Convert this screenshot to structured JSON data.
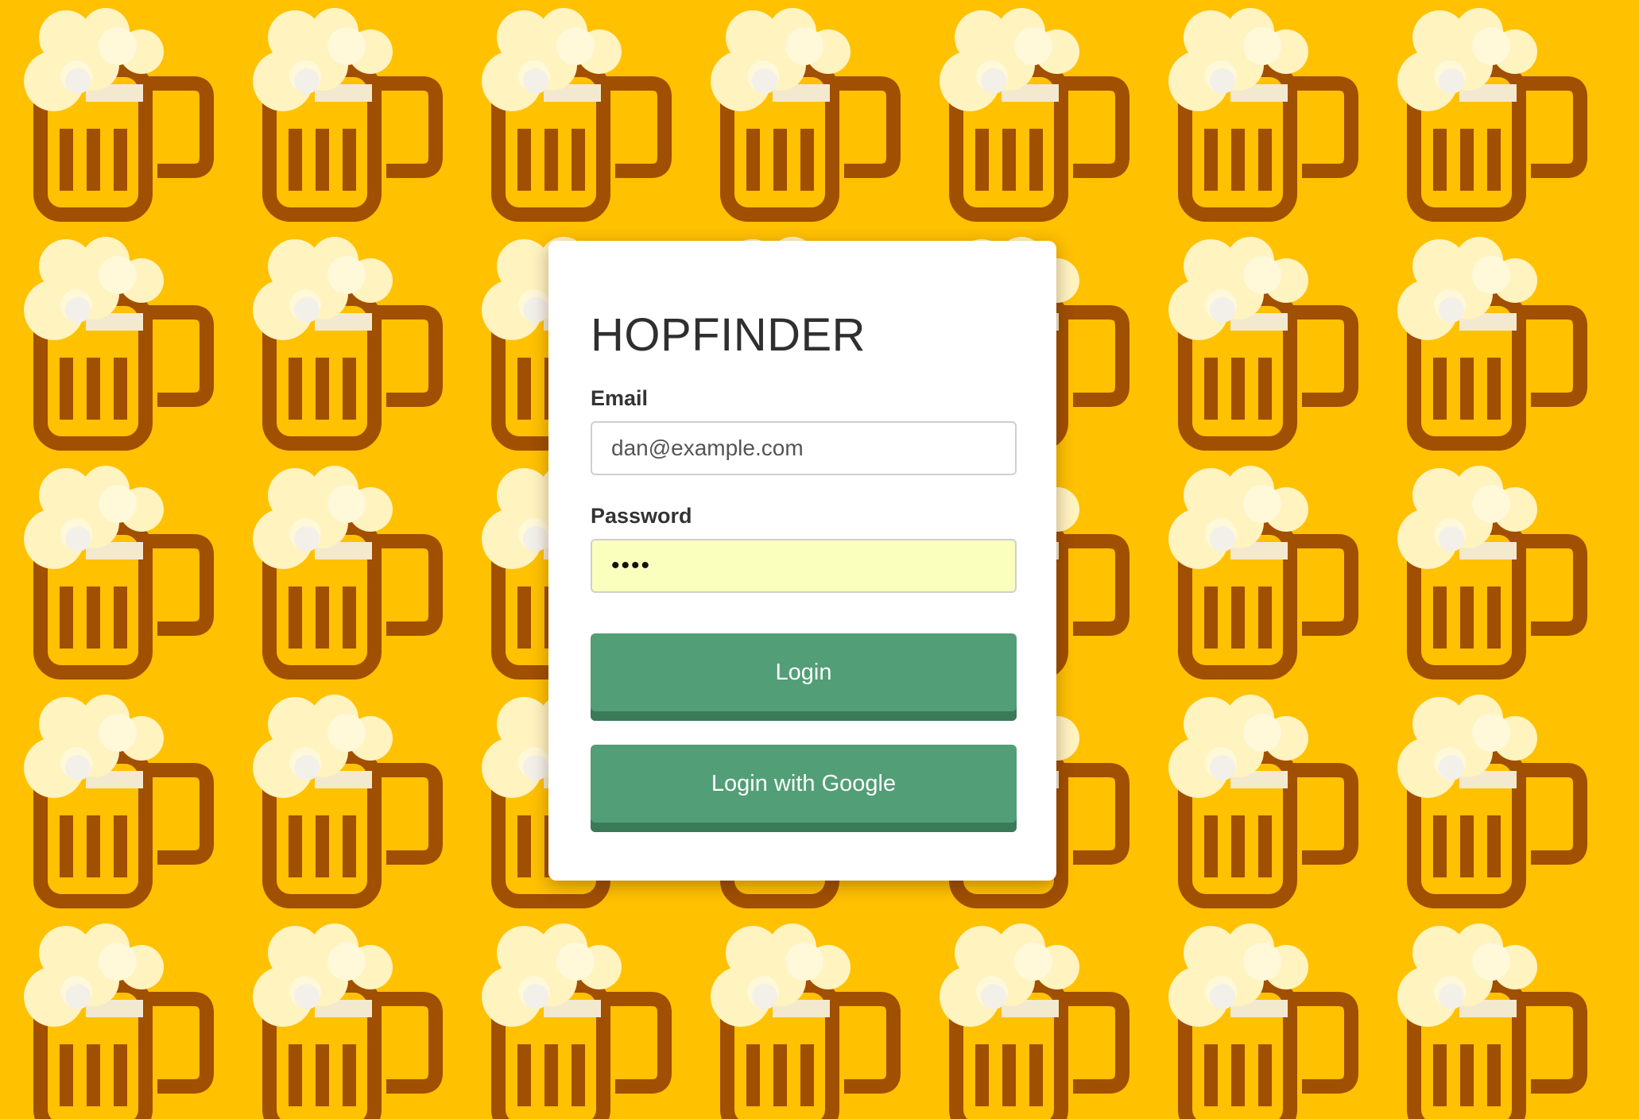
{
  "colors": {
    "background": "#FFC100",
    "mug": "#A14F00",
    "foam": "#FFF3C0",
    "button": "#529E77",
    "password_autofill": "#FAFFBD"
  },
  "background_pattern": {
    "icon": "beer-mug-icon",
    "columns": 7,
    "rows": 5
  },
  "login": {
    "title": "HOPFINDER",
    "email_label": "Email",
    "email_value": "dan@example.com",
    "password_label": "Password",
    "password_value": "••••",
    "login_button": "Login",
    "google_button": "Login with Google"
  }
}
